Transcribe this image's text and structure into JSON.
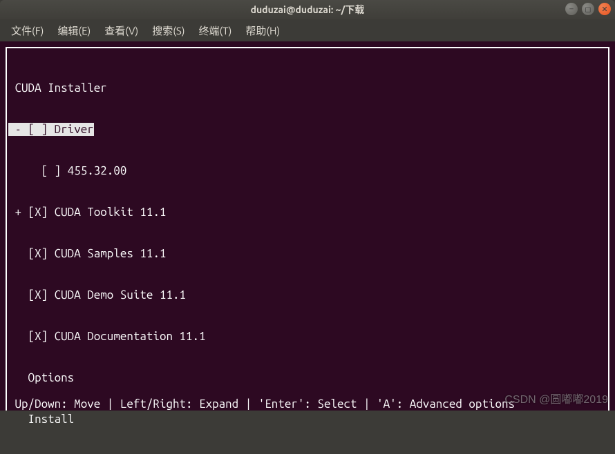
{
  "window": {
    "title": "duduzai@duduzai: ~/下载"
  },
  "menubar": {
    "file": "文件(F)",
    "edit": "编辑(E)",
    "view": "查看(V)",
    "search": "搜索(S)",
    "terminal": "终端(T)",
    "help": "帮助(H)"
  },
  "installer": {
    "header": " CUDA Installer",
    "lines": {
      "driver": " - [ ] Driver",
      "driver_ver": "     [ ] 455.32.00",
      "toolkit": " + [X] CUDA Toolkit 11.1",
      "samples": "   [X] CUDA Samples 11.1",
      "demo": "   [X] CUDA Demo Suite 11.1",
      "docs": "   [X] CUDA Documentation 11.1",
      "options": "   Options",
      "install": "   Install"
    },
    "footer": " Up/Down: Move | Left/Right: Expand | 'Enter': Select | 'A': Advanced options "
  },
  "watermark": "CSDN @圆嘟嘟2019"
}
